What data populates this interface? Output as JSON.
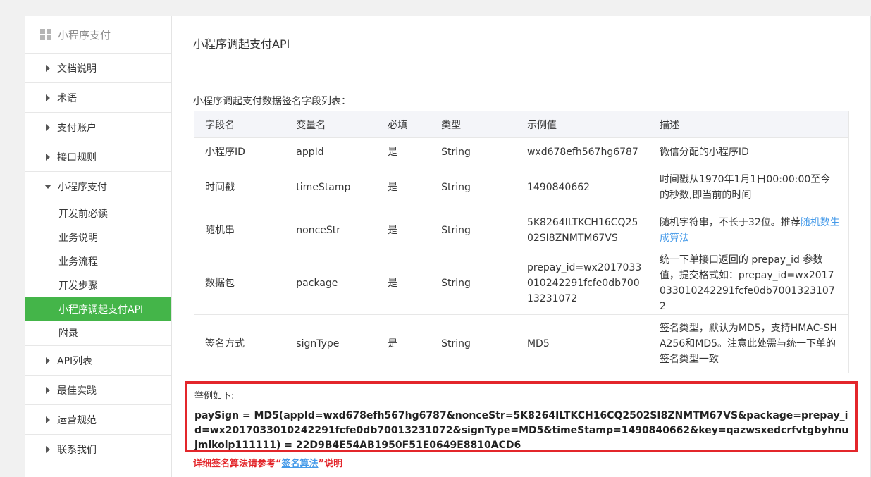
{
  "sidebar": {
    "title": "小程序支付",
    "items": [
      {
        "label": "文档说明"
      },
      {
        "label": "术语"
      },
      {
        "label": "支付账户"
      },
      {
        "label": "接口规则"
      }
    ],
    "open_group": {
      "label": "小程序支付",
      "children": [
        {
          "label": "开发前必读"
        },
        {
          "label": "业务说明"
        },
        {
          "label": "业务流程"
        },
        {
          "label": "开发步骤"
        },
        {
          "label": "小程序调起支付API"
        },
        {
          "label": "附录"
        }
      ]
    },
    "items_after": [
      {
        "label": "API列表"
      },
      {
        "label": "最佳实践"
      },
      {
        "label": "运营规范"
      },
      {
        "label": "联系我们"
      }
    ]
  },
  "main": {
    "title": "小程序调起支付API",
    "intro": "小程序调起支付数据签名字段列表：",
    "table": {
      "headers": [
        "字段名",
        "变量名",
        "必填",
        "类型",
        "示例值",
        "描述"
      ],
      "rows": [
        {
          "name": "小程序ID",
          "var": "appId",
          "required": "是",
          "type": "String",
          "example": "wxd678efh567hg6787",
          "desc": "微信分配的小程序ID"
        },
        {
          "name": "时间戳",
          "var": "timeStamp",
          "required": "是",
          "type": "String",
          "example": "1490840662",
          "desc": "时间戳从1970年1月1日00:00:00至今的秒数,即当前的时间"
        },
        {
          "name": "随机串",
          "var": "nonceStr",
          "required": "是",
          "type": "String",
          "example": "5K8264ILTKCH16CQ2502SI8ZNMTM67VS",
          "desc": "随机字符串，不长于32位。推荐",
          "desc_link": "随机数生成算法"
        },
        {
          "name": "数据包",
          "var": "package",
          "required": "是",
          "type": "String",
          "example": "prepay_id=wx2017033010242291fcfe0db70013231072",
          "desc": "统一下单接口返回的 prepay_id 参数值，提交格式如：prepay_id=wx2017033010242291fcfe0db70013231072"
        },
        {
          "name": "签名方式",
          "var": "signType",
          "required": "是",
          "type": "String",
          "example": "MD5",
          "desc": "签名类型，默认为MD5，支持HMAC-SHA256和MD5。注意此处需与统一下单的签名类型一致"
        }
      ]
    },
    "example": {
      "label": "举例如下:",
      "code": "paySign = MD5(appId=wxd678efh567hg6787&nonceStr=5K8264ILTKCH16CQ2502SI8ZNMTM67VS&package=prepay_id=wx2017033010242291fcfe0db70013231072&signType=MD5&timeStamp=1490840662&key=qazwsxedcrfvtgbyhnujmikolp111111) = 22D9B4E54AB1950F51E0649E8810ACD6"
    },
    "note": {
      "prefix": "详细签名算法请参考“",
      "link": "签名算法",
      "suffix": "”说明"
    }
  },
  "colors": {
    "accent": "#44b549",
    "highlight_border": "#e3262b",
    "link": "#459ae9"
  }
}
